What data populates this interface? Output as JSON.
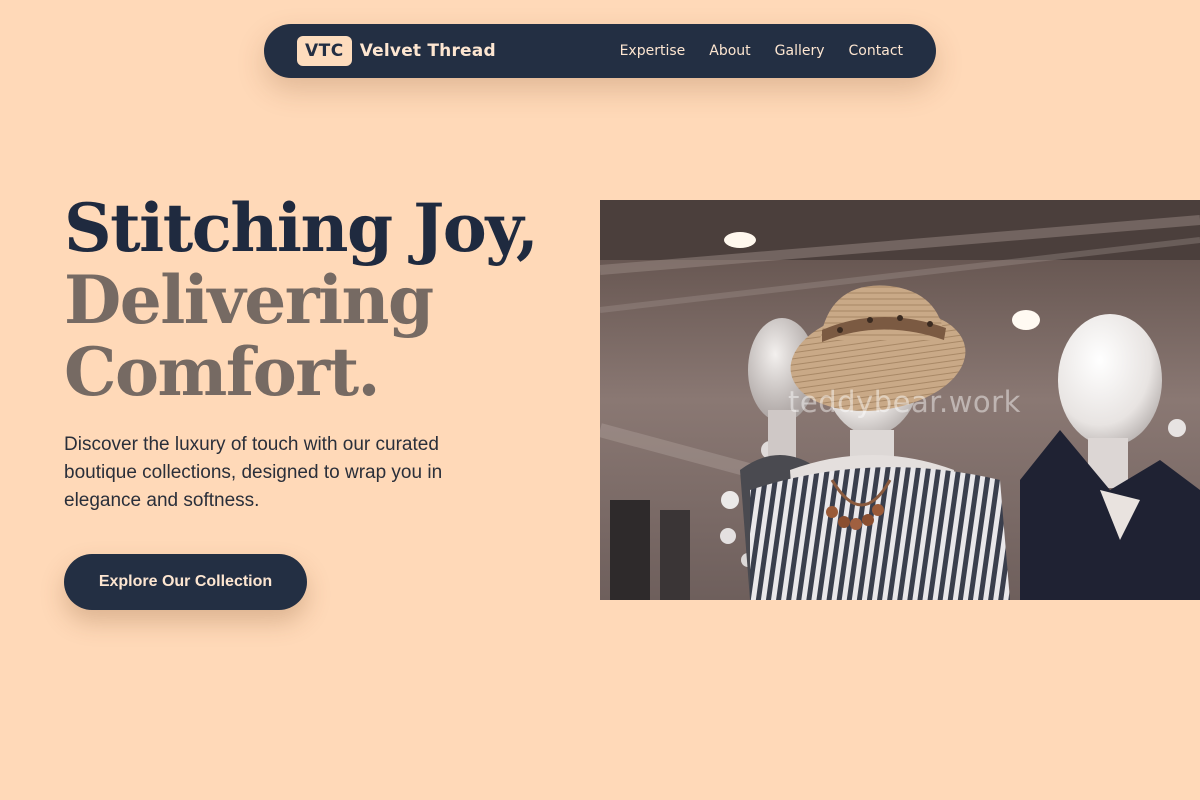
{
  "nav": {
    "logo_badge": "VTC",
    "brand_name": "Velvet Thread",
    "links": [
      {
        "label": "Expertise"
      },
      {
        "label": "About"
      },
      {
        "label": "Gallery"
      },
      {
        "label": "Contact"
      }
    ]
  },
  "hero": {
    "headline_line1": "Stitching Joy,",
    "headline_line2": "Delivering",
    "headline_line3": "Comfort.",
    "description": "Discover the luxury of touch with our curated boutique collections, designed to wrap you in elegance and softness.",
    "cta_label": "Explore Our Collection"
  },
  "image": {
    "watermark": "teddybear.work",
    "subject": "store mannequins wearing a straw sun hat, striped top and navy blazer"
  },
  "colors": {
    "background": "#ffd9b8",
    "primary_navy": "#232f43",
    "muted_headline": "#766a63"
  }
}
